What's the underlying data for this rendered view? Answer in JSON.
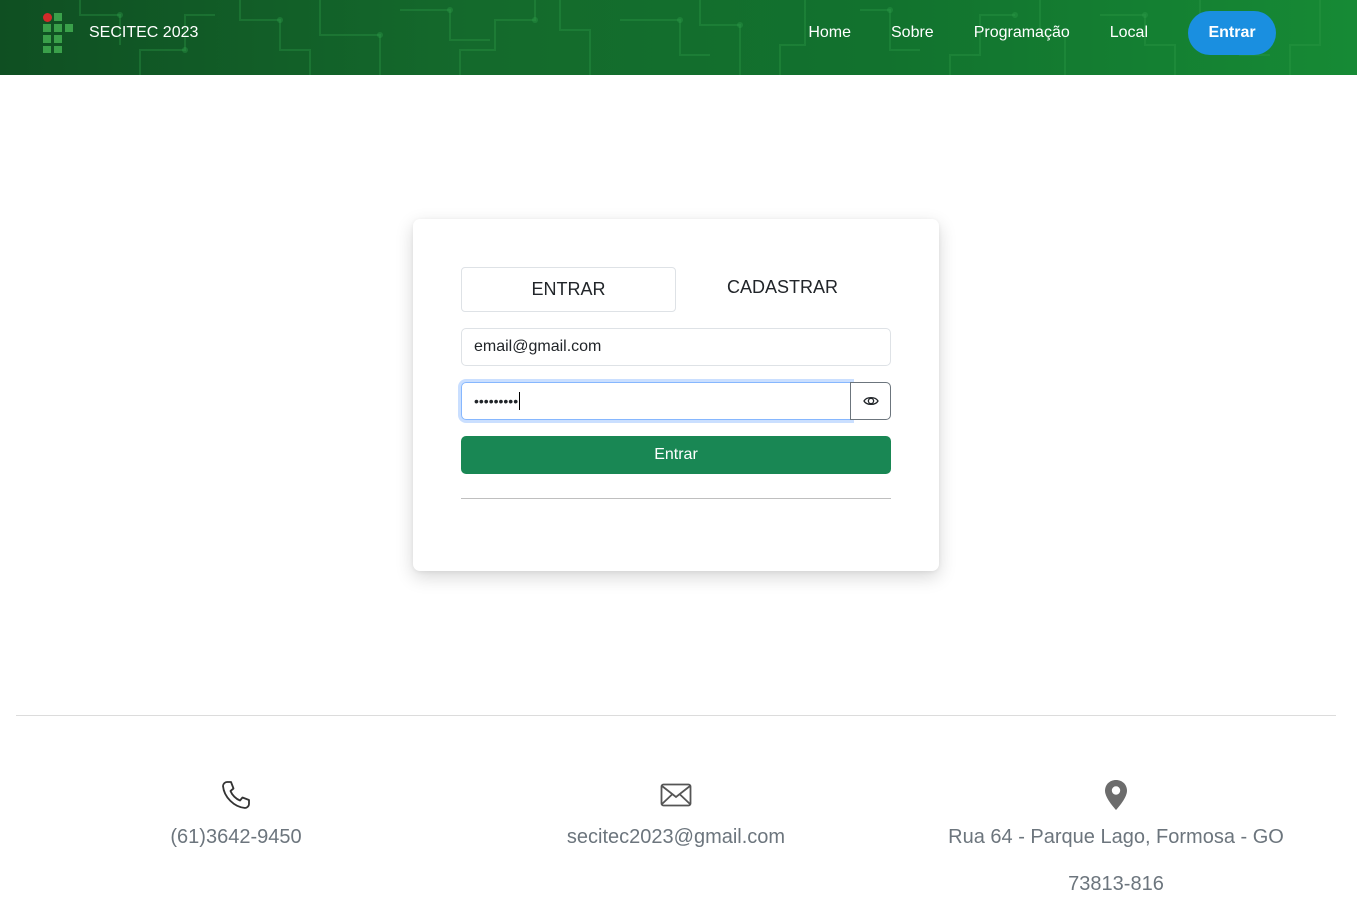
{
  "header": {
    "brand": "SECITEC 2023",
    "nav": [
      "Home",
      "Sobre",
      "Programação",
      "Local"
    ],
    "login_button": "Entrar",
    "colors": {
      "bar": "#146a2c",
      "login_button": "#1a8fe0",
      "logo_green": "#3aa04a",
      "logo_red": "#d22a2a"
    }
  },
  "login_card": {
    "tabs": {
      "active": "ENTRAR",
      "inactive": "CADASTRAR"
    },
    "email_value": "email@gmail.com",
    "password_value": "•••••••••",
    "password_toggle_icon": "eye-icon",
    "submit_label": "Entrar",
    "submit_color": "#198754"
  },
  "footer": {
    "phone": {
      "icon": "phone-icon",
      "text": "(61)3642-9450"
    },
    "email": {
      "icon": "envelope-icon",
      "text": "secitec2023@gmail.com"
    },
    "address": {
      "icon": "location-pin-icon",
      "line1": "Rua 64 - Parque Lago, Formosa - GO",
      "line2": "73813-816"
    }
  }
}
